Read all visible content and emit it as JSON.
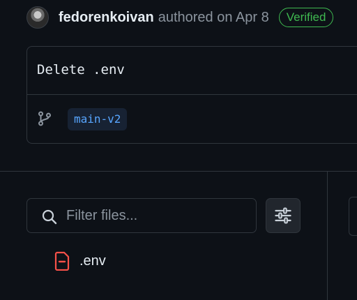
{
  "commit": {
    "author": "fedorenkoivan",
    "authored_text": "authored on Apr 8",
    "verified_label": "Verified",
    "message": "Delete .env",
    "branch": "main-v2"
  },
  "filter": {
    "placeholder": "Filter files..."
  },
  "files": [
    {
      "name": ".env",
      "status": "deleted",
      "icon": "file-diff-removed-icon"
    }
  ],
  "colors": {
    "background": "#0d1117",
    "border": "#30363d",
    "verified": "#3fb950",
    "branch_text": "#58a6ff",
    "deleted": "#f85149",
    "muted_text": "#8b949e"
  }
}
